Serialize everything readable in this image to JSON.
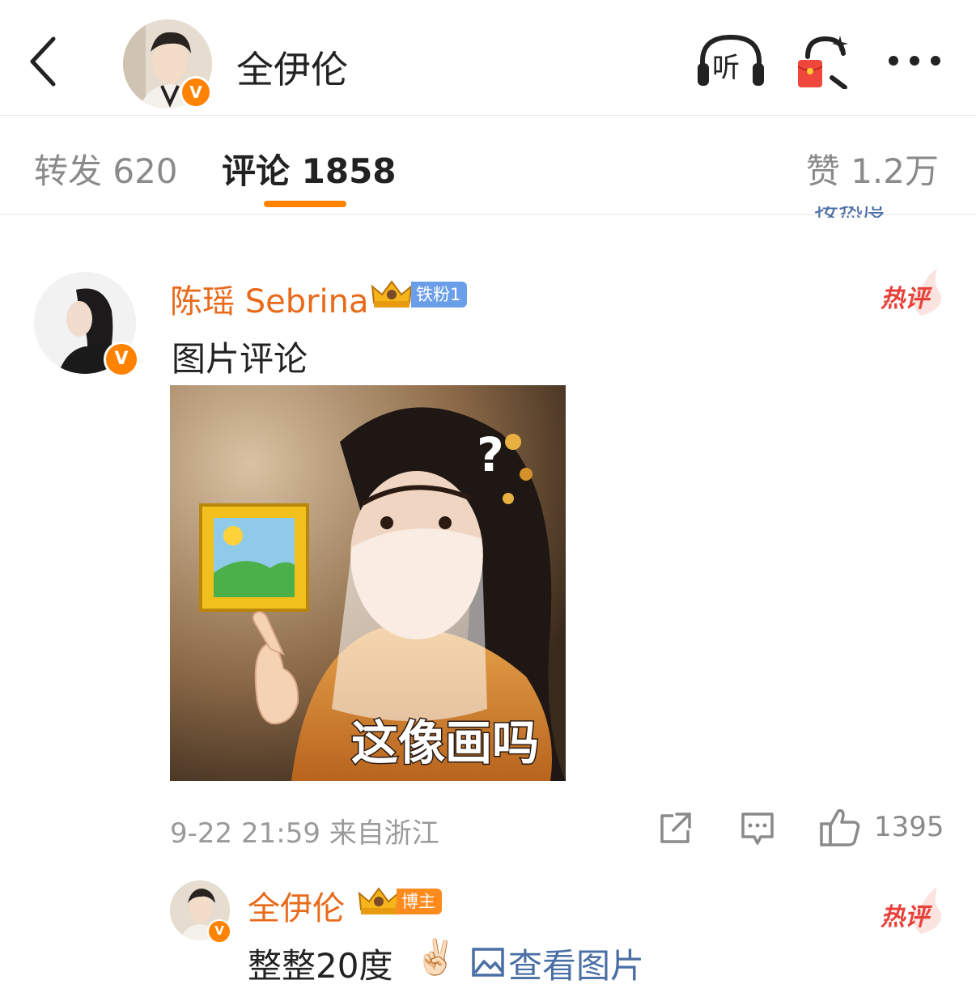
{
  "header": {
    "name": "全伊伦",
    "listen_label": "听",
    "verified_mark": "V"
  },
  "tabs": {
    "repost": "转发 620",
    "comment": "评论 1858",
    "like": "赞 1.2万"
  },
  "sort_peek": "按热度",
  "comment": {
    "username": "陈瑶 Sebrina",
    "fan_badge": "铁粉1",
    "hot_tag": "热评",
    "text": "图片评论",
    "image_caption": "这像画吗",
    "image_mark": "?",
    "meta": "9-22 21:59 来自浙江",
    "like_count": "1395",
    "verified_mark": "V"
  },
  "reply": {
    "username": "全伊伦",
    "host_badge": "博主",
    "hot_tag": "热评",
    "text": "整整20度",
    "emoji": "✌🏻",
    "view_picture": "查看图片",
    "verified_mark": "V"
  },
  "colors": {
    "accent": "#ff8200",
    "username": "#e86a1a",
    "link": "#4a6fa5",
    "hot": "#e8413a",
    "fan_badge": "#6b9ee8"
  }
}
